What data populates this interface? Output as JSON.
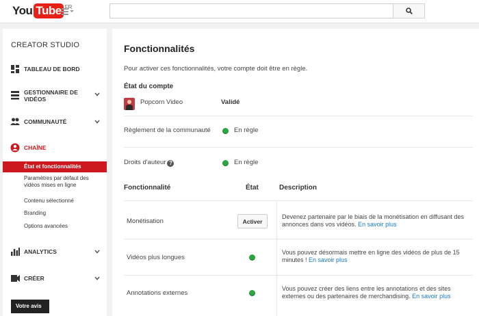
{
  "header": {
    "logo_you": "You",
    "logo_tube": "Tube",
    "logo_region": "FR",
    "search_value": "",
    "search_placeholder": ""
  },
  "sidebar": {
    "title": "CREATOR STUDIO",
    "items": [
      {
        "label": "TABLEAU DE BORD",
        "icon": "dashboard-icon"
      },
      {
        "label": "GESTIONNAIRE DE VIDÉOS",
        "icon": "video-manager-icon"
      },
      {
        "label": "COMMUNAUTÉ",
        "icon": "community-icon"
      },
      {
        "label": "CHAÎNE",
        "icon": "channel-icon"
      },
      {
        "label": "ANALYTICS",
        "icon": "analytics-icon"
      },
      {
        "label": "CRÉER",
        "icon": "create-icon"
      }
    ],
    "channel_subitems": [
      "État et fonctionnalités",
      "Paramètres par défaut des vidéos mises en ligne",
      "Contenu sélectionné",
      "Branding",
      "Options avancées"
    ],
    "bottom_button": "Votre avis"
  },
  "main": {
    "title": "Fonctionnalités",
    "intro": "Pour activer ces fonctionnalités, votre compte doit être en règle.",
    "account_section": "État du compte",
    "account_name": "Popcorn Video",
    "account_status": "Validé",
    "community_label": "Règlement de la communauté",
    "community_status": "En règle",
    "copyright_label": "Droits d'auteur",
    "copyright_status": "En règle",
    "table_headers": {
      "feature": "Fonctionnalité",
      "state": "État",
      "description": "Description"
    },
    "features": [
      {
        "name": "Monétisation",
        "button": "Activer",
        "desc": "Devenez partenaire par le biais de la monétisation en diffusant des annonces dans vos vidéos.",
        "link": "En savoir plus"
      },
      {
        "name": "Vidéos plus longues",
        "desc": "Vous pouvez désormais mettre en ligne des vidéos de plus de 15 minutes !",
        "link": "En savoir plus"
      },
      {
        "name": "Annotations externes",
        "desc": "Vous pouvez créer des liens entre les annotations et des sites externes ou des partenaires de merchandising.",
        "link": "En savoir plus"
      }
    ]
  },
  "colors": {
    "accent_red": "#cc181e",
    "ok_green": "#2ba640",
    "link_blue": "#167ac6"
  }
}
